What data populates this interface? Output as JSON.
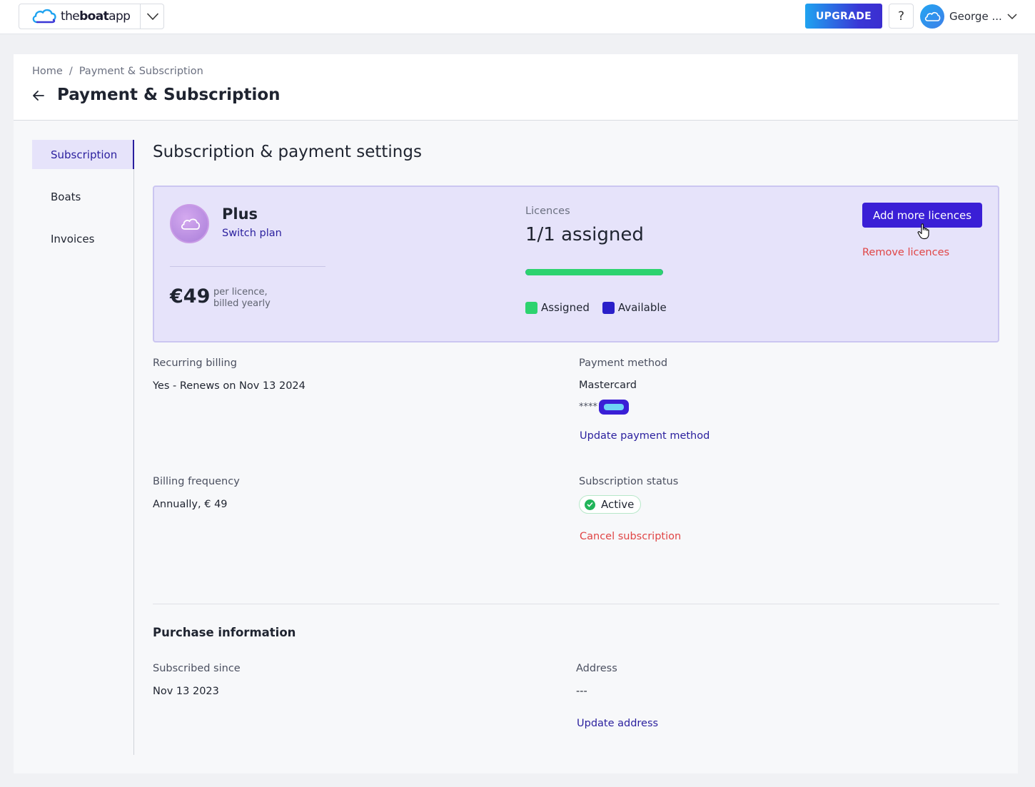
{
  "topbar": {
    "logo_text_thin": "the",
    "logo_text_bold": "boat",
    "logo_text_thin2": "app",
    "upgrade_label": "UPGRADE",
    "help_label": "?",
    "user_name": "George ..."
  },
  "breadcrumb": {
    "items": [
      "Home",
      "Payment & Subscription"
    ],
    "separator": "/"
  },
  "page_title": "Payment & Subscription",
  "sidenav": {
    "items": [
      {
        "label": "Subscription",
        "active": true
      },
      {
        "label": "Boats",
        "active": false
      },
      {
        "label": "Invoices",
        "active": false
      }
    ]
  },
  "section_title": "Subscription & payment settings",
  "plan": {
    "name": "Plus",
    "switch_label": "Switch plan",
    "price": "€49",
    "price_note_line1": "per licence,",
    "price_note_line2": "billed yearly",
    "licences_label": "Licences",
    "licences_value": "1/1 assigned",
    "assigned_fraction": 1.0,
    "legend_assigned": "Assigned",
    "legend_available": "Available",
    "add_button": "Add more licences",
    "remove_link": "Remove licences"
  },
  "details": {
    "recurring_label": "Recurring billing",
    "recurring_value": "Yes - Renews on Nov 13 2024",
    "payment_label": "Payment method",
    "payment_value": "Mastercard",
    "card_mask": "****",
    "update_payment": "Update payment method",
    "frequency_label": "Billing frequency",
    "frequency_value": "Annually, € 49",
    "status_label": "Subscription status",
    "status_value": "Active",
    "cancel_link": "Cancel subscription"
  },
  "purchase": {
    "heading": "Purchase information",
    "since_label": "Subscribed since",
    "since_value": "Nov 13 2023",
    "address_label": "Address",
    "address_value": "---",
    "update_address": "Update address"
  },
  "colors": {
    "accent": "#3a1fd6",
    "assigned": "#2dd36f",
    "available": "#2a1fc9",
    "danger": "#e04545",
    "plan_bg": "#e6e3fa"
  }
}
